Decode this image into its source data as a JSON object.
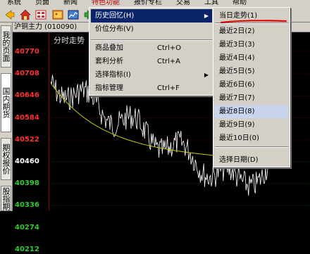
{
  "menubar": {
    "items": [
      "系统",
      "页面",
      "新闻",
      "特色功能",
      "报价专栏",
      "交易",
      "工具",
      "帮助"
    ],
    "active_index": 3
  },
  "toolbar": {
    "icons": [
      "back-arrow-icon",
      "home-icon",
      "grid-icon",
      "picture-icon",
      "chart-icon",
      "forward-arrow-icon",
      "reload-icon"
    ]
  },
  "sidetabs": {
    "items": [
      "我的页面",
      "国内期货",
      "期权报价",
      "股指期货"
    ],
    "selected_index": 1
  },
  "chart": {
    "instrument": "沪铜主力 (010090)",
    "label": "分时走势",
    "price_ticks": [
      "40770",
      "40708",
      "40646",
      "40584",
      "40522",
      "40460",
      "40398",
      "40336",
      "40274",
      "40212"
    ],
    "tick_colors": [
      "#ff3030",
      "#ff3030",
      "#ff3030",
      "#ff3030",
      "#ff3030",
      "#ffffff",
      "#33cc33",
      "#33cc33",
      "#33cc33",
      "#33cc33"
    ],
    "price_color": "#ffffff",
    "average_color": "#c8c800"
  },
  "main_menu": {
    "items": [
      {
        "label": "历史回忆(H)",
        "shortcut": "",
        "submenu": true
      },
      {
        "label": "价位分布(V)",
        "shortcut": "",
        "submenu": false
      },
      {
        "label": "商品叠加",
        "shortcut": "Ctrl+O",
        "submenu": false
      },
      {
        "label": "套利分析",
        "shortcut": "Ctrl+A",
        "submenu": false
      },
      {
        "label": "选择指标(I)",
        "shortcut": "",
        "submenu": true
      },
      {
        "label": "指标管理",
        "shortcut": "Ctrl+F",
        "submenu": false
      }
    ]
  },
  "sub_menu": {
    "items": [
      "当日走势(1)",
      "最近2日(2)",
      "最近3日(3)",
      "最近4日(4)",
      "最近5日(5)",
      "最近6日(6)",
      "最近7日(7)",
      "最近8日(8)",
      "最近9日(9)",
      "最近10日(0)",
      "选择日期(D)"
    ],
    "hover_index": 7
  },
  "annotation_color": "#e00000"
}
